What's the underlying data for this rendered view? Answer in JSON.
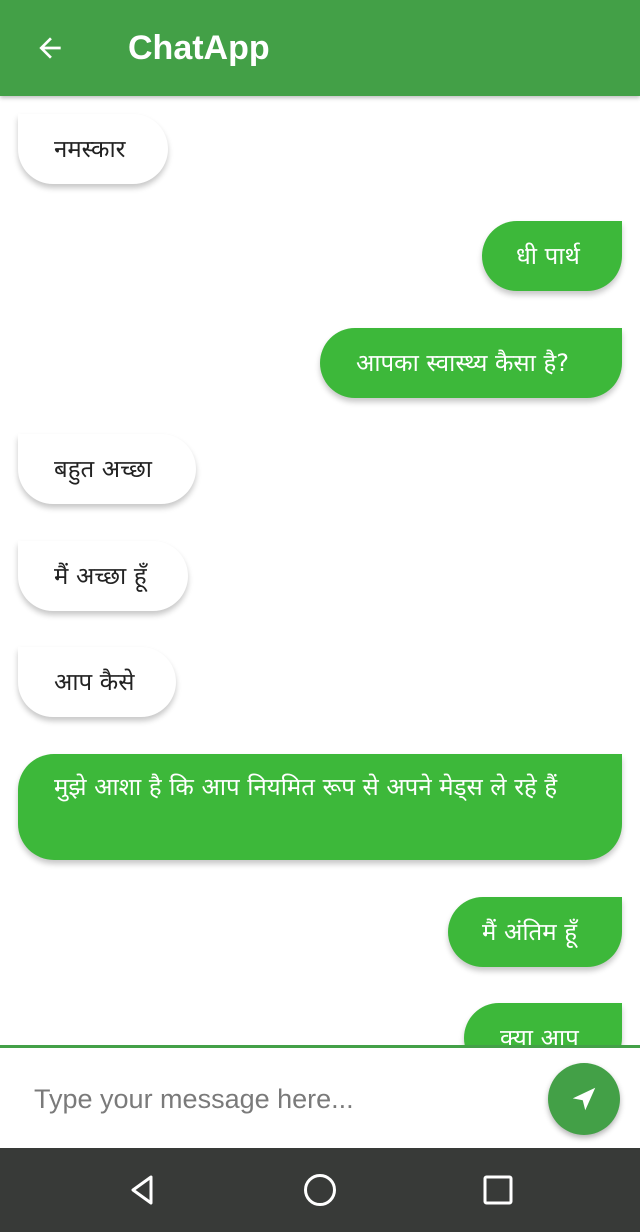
{
  "app_bar": {
    "title": "ChatApp",
    "back_icon": "arrow-left-icon",
    "color": "#43a047"
  },
  "messages": [
    {
      "direction": "incoming",
      "text": "नमस्कार"
    },
    {
      "direction": "outgoing",
      "text": "धी पार्थ"
    },
    {
      "direction": "outgoing",
      "text": "आपका स्वास्थ्य कैसा है?"
    },
    {
      "direction": "incoming",
      "text": "बहुत अच्छा"
    },
    {
      "direction": "incoming",
      "text": "मैं अच्छा हूँ"
    },
    {
      "direction": "incoming",
      "text": "आप कैसे"
    },
    {
      "direction": "outgoing",
      "text": "मुझे आशा है कि आप नियमित रूप से अपने मेड्स ले रहे हैं"
    },
    {
      "direction": "outgoing",
      "text": "मैं अंतिम हूँ"
    },
    {
      "direction": "outgoing",
      "text": "क्या आप"
    }
  ],
  "composer": {
    "value": "",
    "placeholder": "Type your message here...",
    "send_icon": "send-icon"
  },
  "nav_bar": {
    "back_icon": "nav-back-icon",
    "home_icon": "nav-home-icon",
    "recents_icon": "nav-recents-icon"
  },
  "colors": {
    "primary": "#43a047",
    "outgoing_bubble": "#3db83a",
    "incoming_bubble": "#ffffff",
    "nav_bar": "#383a38"
  }
}
